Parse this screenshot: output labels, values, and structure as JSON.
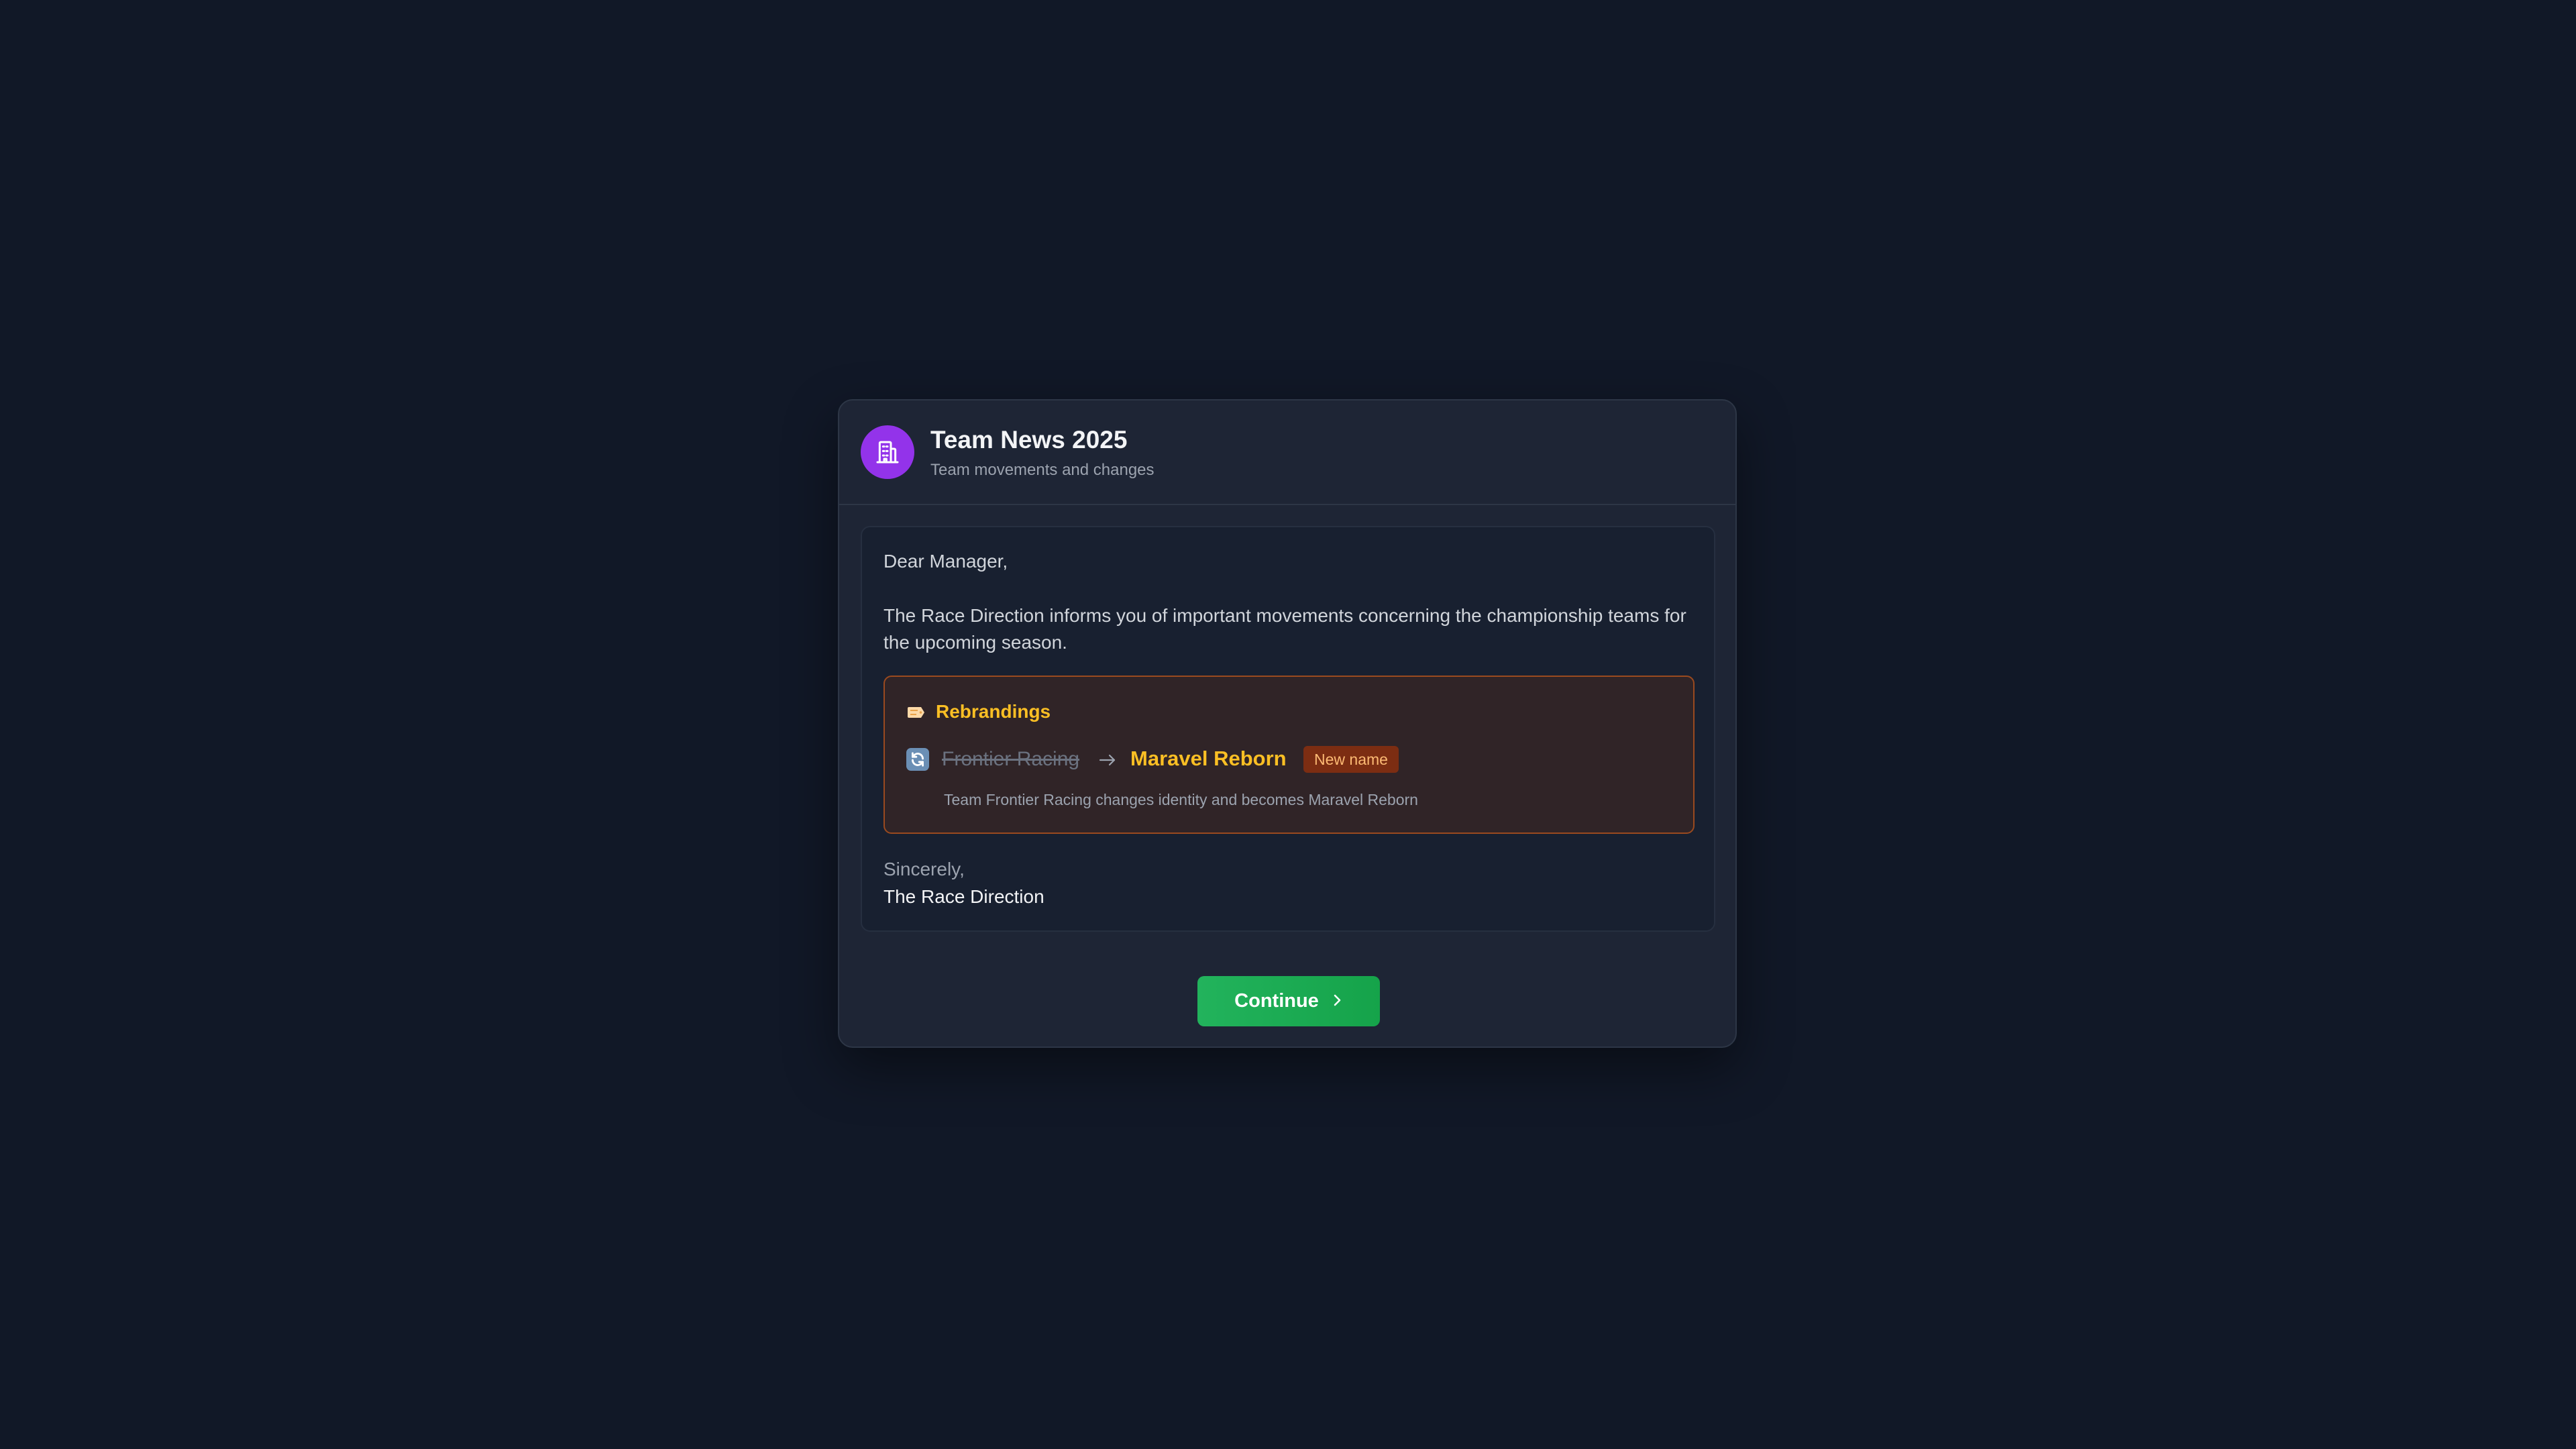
{
  "header": {
    "title": "Team News 2025",
    "subtitle": "Team movements and changes",
    "icon": "building-icon",
    "icon_bg": "#9333ea"
  },
  "letter": {
    "greeting": "Dear Manager,",
    "intro": "The Race Direction informs you of important movements concerning the championship teams for the upcoming season.",
    "rebrandings": {
      "title": "Rebrandings",
      "title_icon": "label-tag-icon",
      "items": [
        {
          "icon": "refresh-icon",
          "old_name": "Frontier Racing",
          "new_name": "Maravel Reborn",
          "badge": "New name",
          "description": "Team Frontier Racing changes identity and becomes Maravel Reborn"
        }
      ]
    },
    "closing": "Sincerely,",
    "signature": "The Race Direction"
  },
  "actions": {
    "continue_label": "Continue"
  },
  "colors": {
    "background": "#111827",
    "accent_orange": "#fbbf24",
    "button_green": "#16a34a"
  }
}
